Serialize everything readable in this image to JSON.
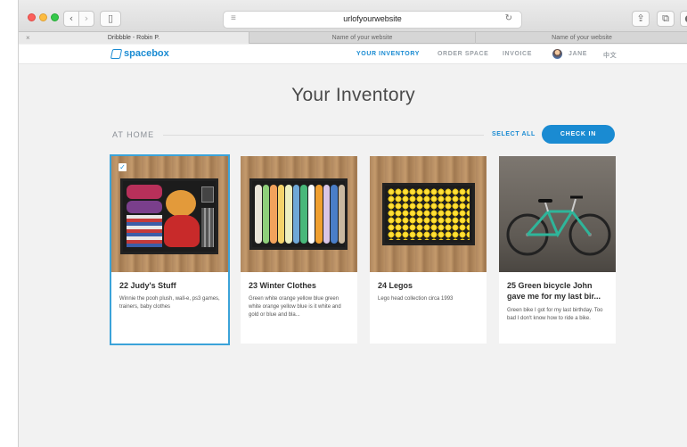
{
  "browser": {
    "url": "urlofyourwebsite",
    "tabs": [
      {
        "label": "Dribbble - Robin P.",
        "active": true
      },
      {
        "label": "Name of your website",
        "active": false
      },
      {
        "label": "Name of your website",
        "active": false
      }
    ]
  },
  "site": {
    "logo_text": "spacebox",
    "nav": [
      {
        "label": "YOUR INVENTORY",
        "active": true
      },
      {
        "label": "ORDER SPACE",
        "active": false
      },
      {
        "label": "INVOICE",
        "active": false
      }
    ],
    "user_name": "JANE",
    "language": "中文",
    "accent_color": "#1a8bd2"
  },
  "page": {
    "title": "Your Inventory",
    "section_label": "AT HOME",
    "select_all": "SELECT ALL",
    "check_in": "CHECK IN"
  },
  "items": [
    {
      "title": "22 Judy's Stuff",
      "description": "Winnie the pooh plush, wall-e, ps3 games, trainers, baby clothes",
      "selected": true
    },
    {
      "title": "23 Winter Clothes",
      "description": "Green white orange yellow blue green white orange yellow blue is it white and gold or blue and bla...",
      "selected": false
    },
    {
      "title": "24 Legos",
      "description": "Lego head collection circa 1993",
      "selected": false
    },
    {
      "title": "25 Green bicycle John gave me for my last bir...",
      "description": "Green bike I got for my last birthday. Too bad I don't know how to ride a bike.",
      "selected": false
    }
  ]
}
